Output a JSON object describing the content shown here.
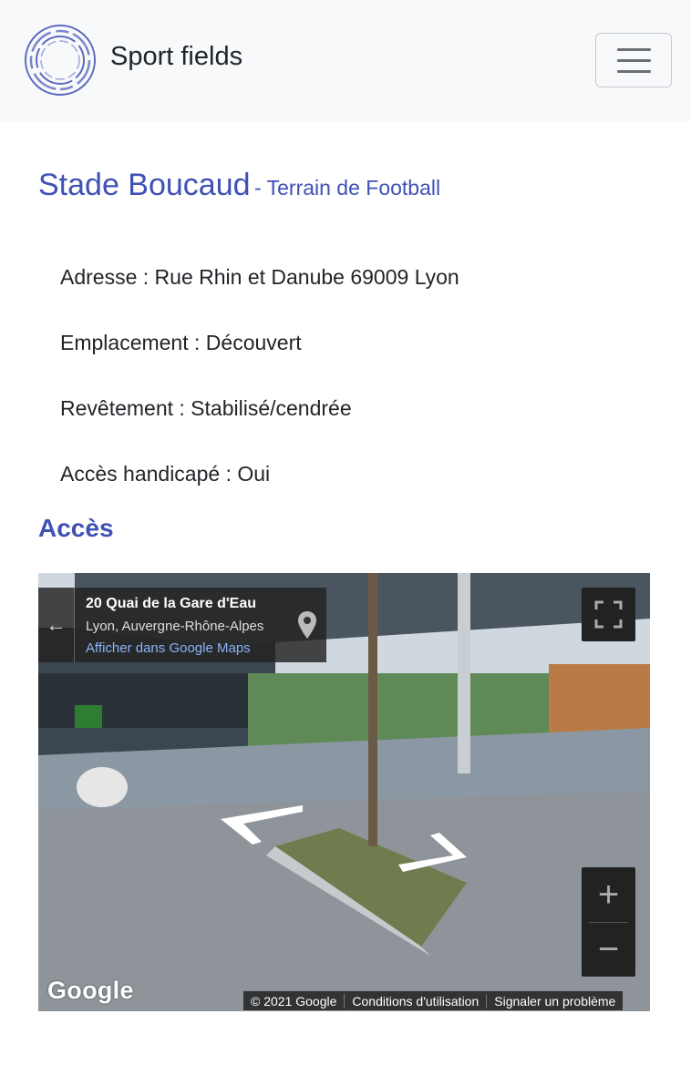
{
  "header": {
    "brand": "Sport fields",
    "logo": "circle-logo-icon",
    "menu_icon": "hamburger-menu-icon"
  },
  "field": {
    "name": "Stade Boucaud",
    "subtitle": "- Terrain de Football",
    "details": [
      "Adresse : Rue Rhin et Danube 69009 Lyon",
      "Emplacement : Découvert",
      "Revêtement : Stabilisé/cendrée",
      "Accès handicapé : Oui"
    ]
  },
  "access": {
    "heading": "Accès"
  },
  "streetview": {
    "address_title": "20 Quai de la Gare d'Eau",
    "address_region": "Lyon, Auvergne-Rhône-Alpes",
    "maps_link": "Afficher dans Google Maps",
    "google_logo": "Google",
    "copyright": "© 2021 Google",
    "terms": "Conditions d'utilisation",
    "report": "Signaler un problème",
    "zoom_in": "+",
    "zoom_out": "−"
  },
  "colors": {
    "accent": "#3f51b5",
    "navbar_bg": "#f8f9fa",
    "text": "#212529"
  }
}
